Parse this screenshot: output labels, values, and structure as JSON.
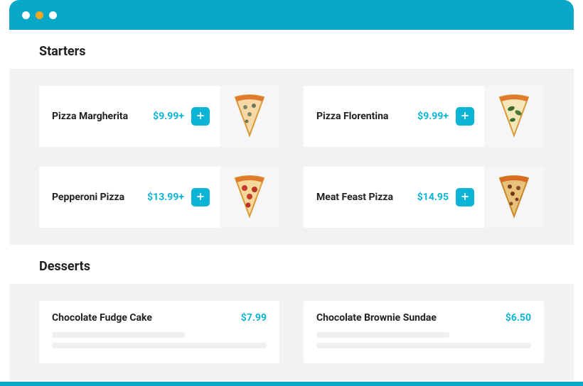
{
  "sections": {
    "starters": {
      "title": "Starters",
      "items": [
        {
          "name": "Pizza Margherita",
          "price": "$9.99+"
        },
        {
          "name": "Pizza Florentina",
          "price": "$9.99+"
        },
        {
          "name": "Pepperoni Pizza",
          "price": "$13.99+"
        },
        {
          "name": "Meat Feast Pizza",
          "price": "$14.95"
        }
      ]
    },
    "desserts": {
      "title": "Desserts",
      "items": [
        {
          "name": "Chocolate Fudge Cake",
          "price": "$7.99"
        },
        {
          "name": "Chocolate Brownie Sundae",
          "price": "$6.50"
        }
      ]
    }
  },
  "colors": {
    "brand": "#09a8c6",
    "accent": "#0bb4d4"
  }
}
